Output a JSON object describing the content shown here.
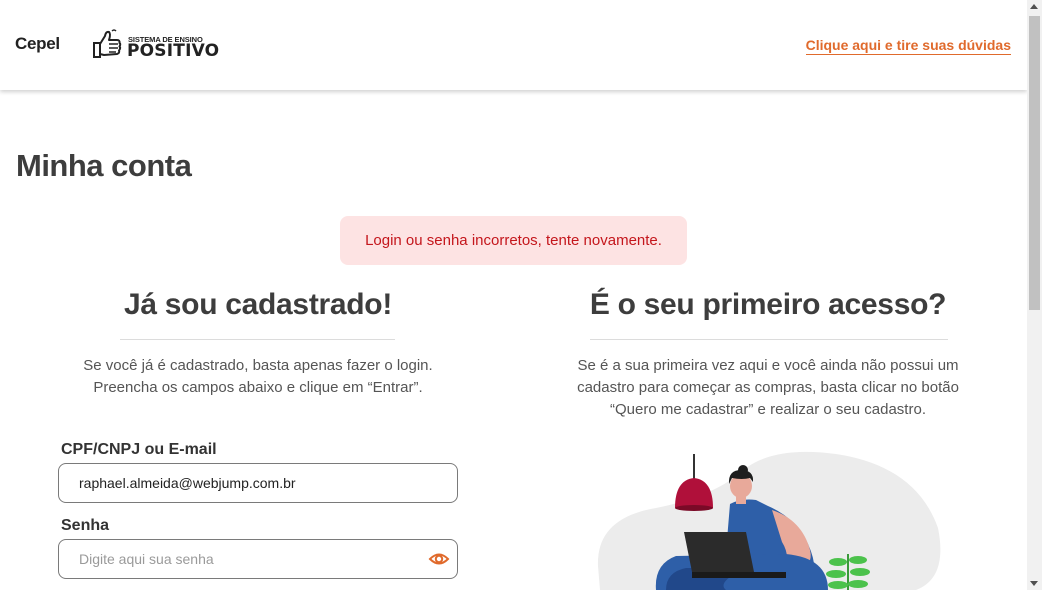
{
  "header": {
    "brand_cepel": "Cepel",
    "brand_positivo_small": "SISTEMA DE ENSINO",
    "brand_positivo_big": "POSITIVO",
    "help_link": "Clique aqui e tire suas dúvidas"
  },
  "page": {
    "title": "Minha conta",
    "error_message": "Login ou senha incorretos, tente novamente."
  },
  "login": {
    "title": "Já sou cadastrado!",
    "description_line1": "Se você já é cadastrado, basta apenas fazer o login.",
    "description_line2": "Preencha os campos abaixo e clique em “Entrar”.",
    "cpf_label": "CPF/CNPJ ou E-mail",
    "cpf_value": "raphael.almeida@webjump.com.br",
    "password_label": "Senha",
    "password_placeholder": "Digite aqui sua senha"
  },
  "register": {
    "title": "É o seu primeiro acesso?",
    "description_line1": "Se é a sua primeira vez aqui e você ainda não possui um",
    "description_line2": "cadastro para começar as compras, basta clicar no botão",
    "description_line3": "“Quero me cadastrar” e realizar o seu cadastro."
  },
  "colors": {
    "accent": "#e06a2c",
    "error_text": "#c4161c",
    "error_bg": "#fde3e3",
    "title": "#3d3d3d"
  },
  "icons": {
    "thumb": "thumbs-up-logo",
    "eye": "eye-icon"
  }
}
